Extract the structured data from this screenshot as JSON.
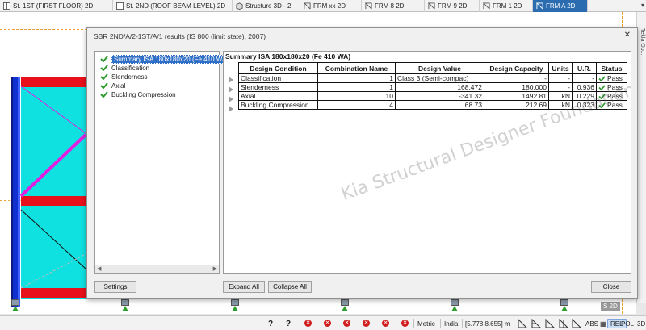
{
  "tabs": [
    {
      "label": "St. 1ST (FIRST FLOOR) 2D",
      "icon": "floor-plan-icon"
    },
    {
      "label": "St. 2ND (ROOF BEAM LEVEL) 2D",
      "icon": "floor-plan-icon"
    },
    {
      "label": "Structure 3D -  2",
      "icon": "structure-3d-icon"
    },
    {
      "label": "FRM xx 2D",
      "icon": "frame-icon"
    },
    {
      "label": "FRM 8 2D",
      "icon": "frame-icon"
    },
    {
      "label": "FRM 9 2D",
      "icon": "frame-icon"
    },
    {
      "label": "FRM 1 2D",
      "icon": "frame-icon"
    },
    {
      "label": "FRM A 2D",
      "icon": "frame-icon",
      "active": true
    }
  ],
  "side_label": "Tekla Ob...",
  "dialog": {
    "title": "SBR 2ND/A/2-1ST/A/1 results (IS 800 (limit state), 2007)",
    "close_glyph": "✕",
    "tree": {
      "items": [
        {
          "label": "Summary ISA 180x180x20 (Fe 410 WA)",
          "selected": true
        },
        {
          "label": "Classification"
        },
        {
          "label": "Slenderness"
        },
        {
          "label": "Axial"
        },
        {
          "label": "Buckling Compression"
        }
      ]
    },
    "summary_title": "Summary ISA 180x180x20 (Fe 410 WA)",
    "table": {
      "headers": [
        "Design Condition",
        "Combination Name",
        "Design Value",
        "Design Capacity",
        "Units",
        "U.R.",
        "Status"
      ],
      "rows": [
        {
          "condition": "Classification",
          "combination": "1",
          "value": "Class 3 (Semi-compac)",
          "capacity": "-",
          "units": "-",
          "ur": "-",
          "status": "Pass"
        },
        {
          "condition": "Slenderness",
          "combination": "1",
          "value": "168.472",
          "capacity": "180.000",
          "units": "-",
          "ur": "0.936",
          "status": "Pass"
        },
        {
          "condition": "Axial",
          "combination": "10",
          "value": "-341.32",
          "capacity": "1492.81",
          "units": "kN",
          "ur": "0.229",
          "status": "Pass"
        },
        {
          "condition": "Buckling Compression",
          "combination": "4",
          "value": "68.73",
          "capacity": "212.69",
          "units": "kN",
          "ur": "0.323",
          "status": "Pass"
        }
      ]
    },
    "watermark": "Kia Structural Designer Foundation",
    "buttons": {
      "settings": "Settings",
      "expand_all": "Expand All",
      "collapse_all": "Collapse All",
      "close": "Close"
    }
  },
  "canvas": {
    "badge": "S 2D"
  },
  "statusbar": {
    "help1": "?",
    "help2": "?",
    "units": "Metric",
    "region": "India",
    "coords": "[5.778,8.655] m",
    "abs": "ABS",
    "rel": "REL",
    "pol": "POL",
    "mode3d": "3D"
  },
  "colors": {
    "accent": "#2b6cb0",
    "pass_check": "#2e9a2e",
    "beam_red": "#e8101a",
    "bay_cyan": "#0fe0e0",
    "brace_magenta": "#e020e0",
    "column_blue": "#1030d0"
  }
}
